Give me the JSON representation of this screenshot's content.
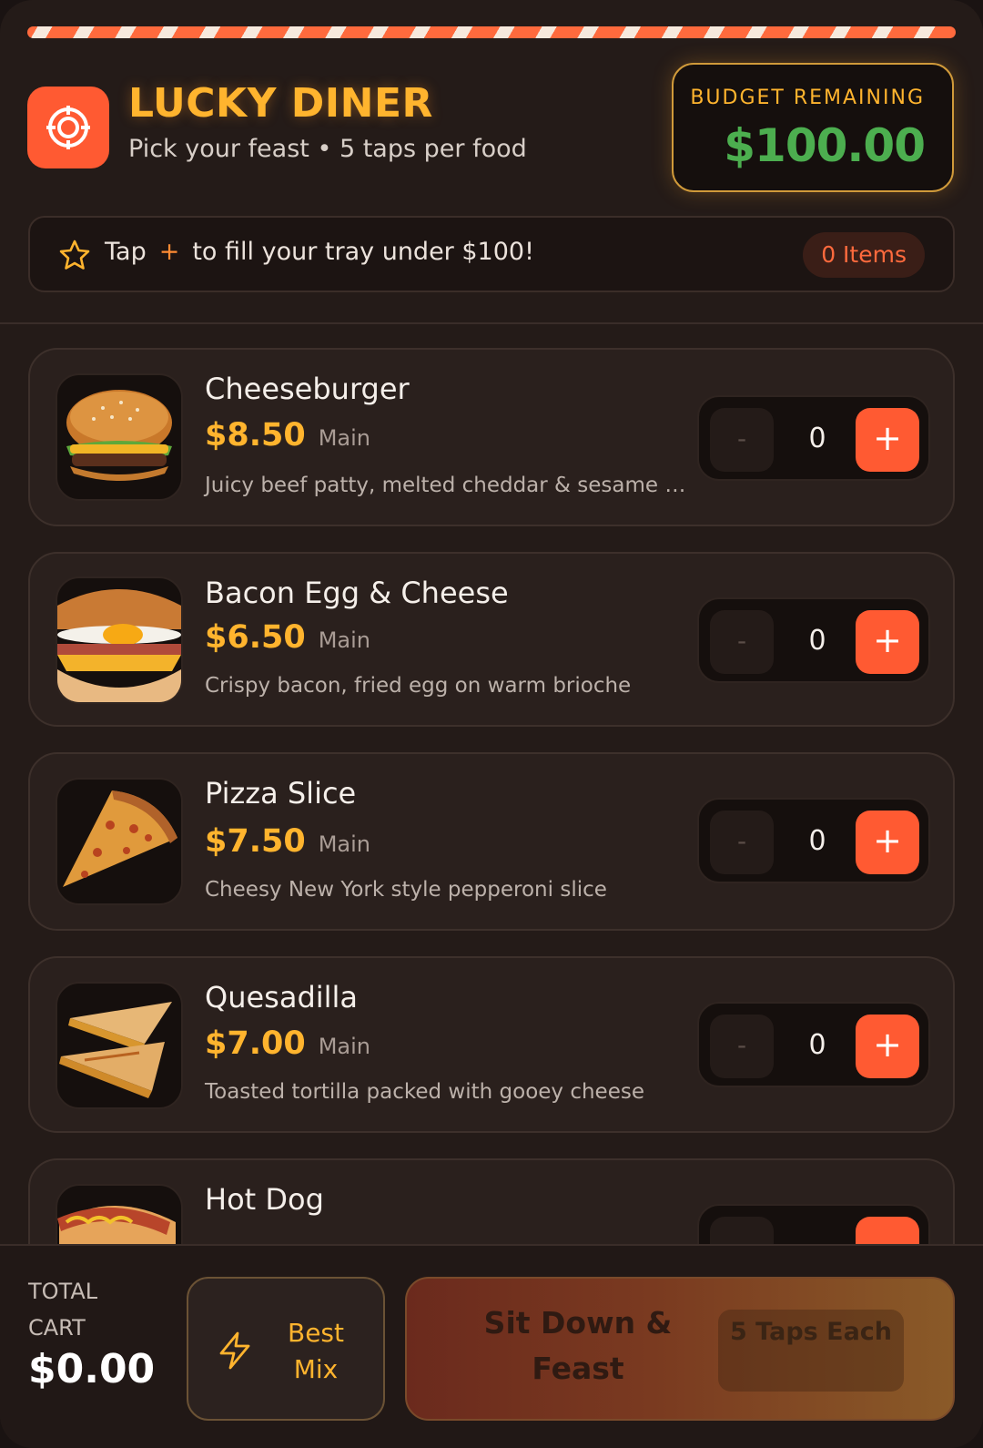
{
  "header": {
    "title": "LUCKY DINER",
    "subtitle": "Pick your feast • 5 taps per food",
    "budget_label": "BUDGET REMAINING",
    "budget_value": "$100.00"
  },
  "tip": {
    "prefix": "Tap",
    "plus_symbol": "+",
    "suffix": "to fill your tray under $100!",
    "items_badge": "0 Items"
  },
  "menu": {
    "items": [
      {
        "name": "Cheeseburger",
        "price": "$8.50",
        "category": "Main",
        "description": "Juicy beef patty, melted cheddar & sesame …",
        "minus": "-",
        "quantity": "0",
        "plus": "+",
        "image": "cheeseburger-image"
      },
      {
        "name": "Bacon Egg & Cheese",
        "price": "$6.50",
        "category": "Main",
        "description": "Crispy bacon, fried egg on warm brioche",
        "minus": "-",
        "quantity": "0",
        "plus": "+",
        "image": "bacon-egg-cheese-image"
      },
      {
        "name": "Pizza Slice",
        "price": "$7.50",
        "category": "Main",
        "description": "Cheesy New York style pepperoni slice",
        "minus": "-",
        "quantity": "0",
        "plus": "+",
        "image": "pizza-slice-image"
      },
      {
        "name": "Quesadilla",
        "price": "$7.00",
        "category": "Main",
        "description": "Toasted tortilla packed with gooey cheese",
        "minus": "-",
        "quantity": "0",
        "plus": "+",
        "image": "quesadilla-image"
      },
      {
        "name": "Hot Dog",
        "image": "hot-dog-image"
      }
    ]
  },
  "footer": {
    "total_label": "TOTAL CART",
    "total_value": "$0.00",
    "best_mix_label": "Best Mix",
    "feast_label": "Sit Down & Feast",
    "feast_badge": "5 Taps Each"
  },
  "colors": {
    "accent_orange": "#ff5a32",
    "gold": "#ffb42e",
    "budget_green": "#4cae4f",
    "background": "#241b18"
  },
  "icons": {
    "logo": "target-icon",
    "tip": "star-icon",
    "best_mix": "lightning-icon"
  }
}
